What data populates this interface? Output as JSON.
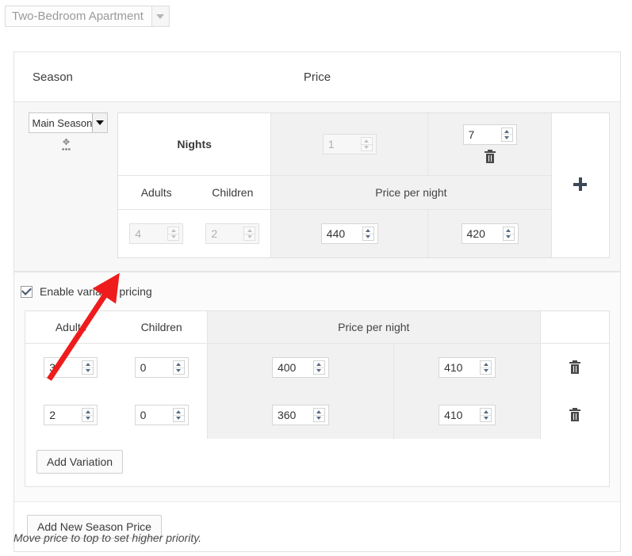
{
  "accommodation_select": {
    "value": "Two-Bedroom Apartment",
    "arrow_icon": "chevron-down-icon"
  },
  "table_header": {
    "season": "Season",
    "price": "Price"
  },
  "season_row": {
    "season_select_value": "Main Season",
    "drag_handle_icon": "move-handle-icon",
    "drag_handle_glyph": "✥",
    "drag_dots_glyph": "•••",
    "nights_label": "Nights",
    "nights_min_value": "1",
    "nights_max_value": "7",
    "adults_label": "Adults",
    "children_label": "Children",
    "price_per_night_label": "Price per night",
    "adults_value": "4",
    "children_value": "2",
    "price_mid_value": "440",
    "price_right_value": "420",
    "delete_icon": "trash-icon",
    "add_icon": "plus-icon"
  },
  "variable_pricing": {
    "checkbox_checked": true,
    "checkbox_label": "Enable variable pricing",
    "columns": {
      "adults": "Adults",
      "children": "Children",
      "price_per_night": "Price per night"
    },
    "variations": [
      {
        "adults": "3",
        "children": "0",
        "price_mid": "400",
        "price_right": "410",
        "delete_icon": "trash-icon"
      },
      {
        "adults": "2",
        "children": "0",
        "price_mid": "360",
        "price_right": "410",
        "delete_icon": "trash-icon"
      }
    ],
    "add_variation_label": "Add Variation"
  },
  "footer": {
    "add_new_season_price_label": "Add New Season Price",
    "note": "Move price to top to set higher priority."
  },
  "annotation": {
    "arrow_color": "#ee1c1c",
    "points_to": "enable-variable-pricing-checkbox"
  }
}
